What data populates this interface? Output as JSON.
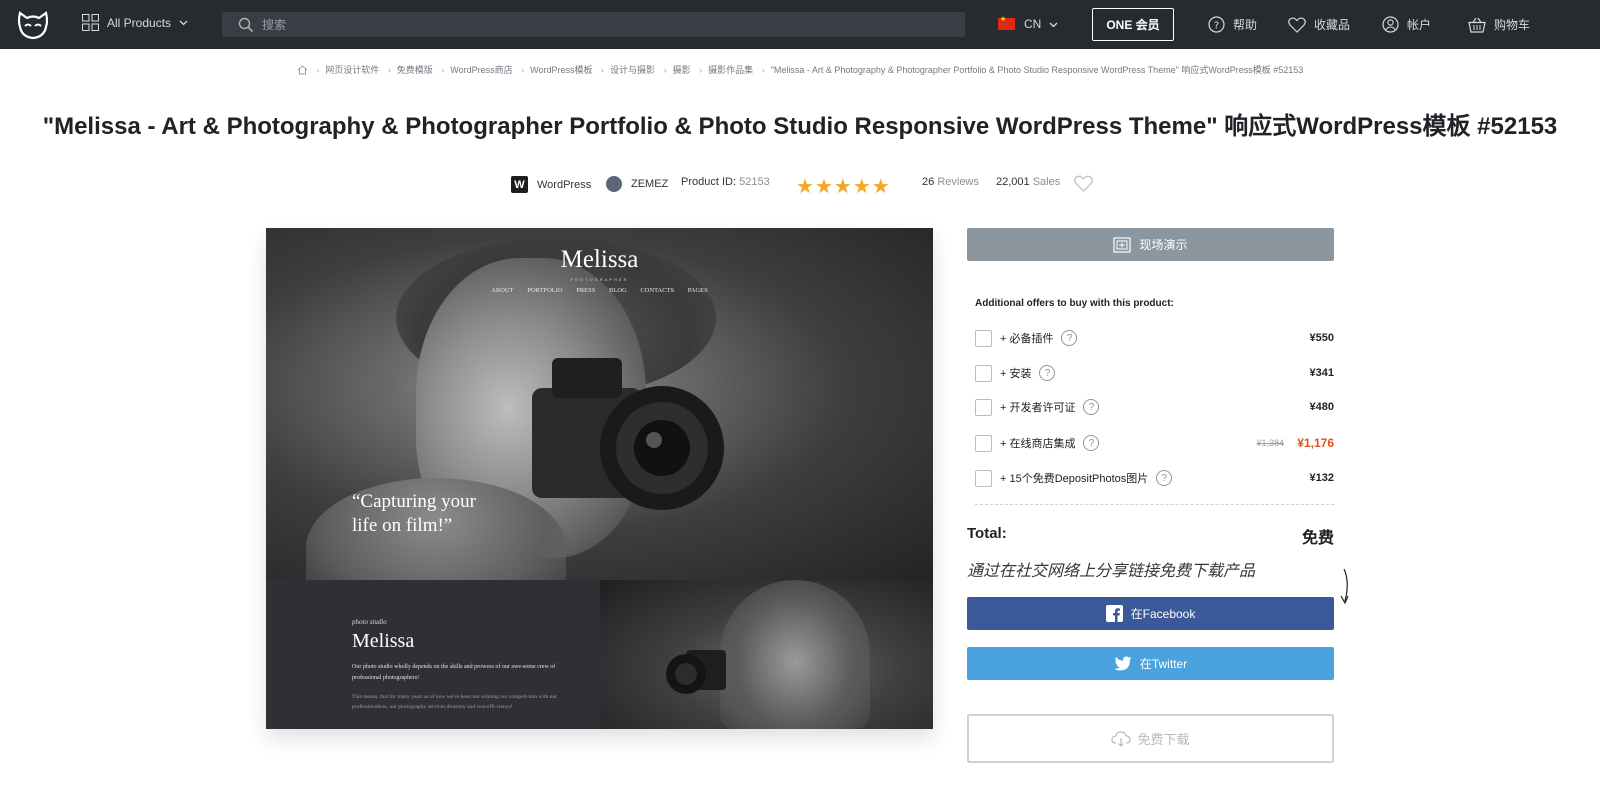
{
  "header": {
    "all_products": "All Products",
    "search_placeholder": "搜索",
    "lang": "CN",
    "one_member": "ONE 会员",
    "help": "帮助",
    "favorites": "收藏品",
    "account": "帐户",
    "cart": "购物车"
  },
  "breadcrumb": [
    "网页设计软件",
    "免费模版",
    "WordPress商店",
    "WordPress模板",
    "设计与摄影",
    "摄影",
    "摄影作品集",
    "\"Melissa - Art & Photography & Photographer Portfolio & Photo Studio Responsive WordPress Theme\" 响应式WordPress模板 #52153"
  ],
  "title": "\"Melissa - Art & Photography & Photographer Portfolio & Photo Studio Responsive WordPress Theme\" 响应式WordPress模板 #52153",
  "meta": {
    "platform": "WordPress",
    "author": "ZEMEZ",
    "product_id_label": "Product ID:",
    "product_id": "52153",
    "rating_stars": 5,
    "reviews_count": "26",
    "reviews_label": "Reviews",
    "sales_count": "22,001",
    "sales_label": "Sales"
  },
  "preview": {
    "brand": "Melissa",
    "brand_sub": "PHOTOGRAPHER",
    "menu": [
      "ABOUT",
      "PORTFOLIO",
      "PRESS",
      "BLOG",
      "CONTACTS",
      "PAGES"
    ],
    "quote": "“Capturing your\nlife on film!”",
    "studio_small": "photo studio",
    "studio_name": "Melissa",
    "studio_text1": "Our photo studio wholly depends on the skills and prowess of our awe-some crew of professional photographers!",
    "studio_text2": "This means, that for many years as of now we've been not winning our competi-tion with our professionalism, our photography services diversity and cost-effi-ciency!"
  },
  "panel": {
    "demo_label": "现场演示",
    "offers_title": "Additional offers to buy with this product:",
    "offers": [
      {
        "label": "+ 必备插件",
        "price": "¥550"
      },
      {
        "label": "+ 安装",
        "price": "¥341"
      },
      {
        "label": "+ 开发者许可证",
        "price": "¥480"
      },
      {
        "label": "+ 在线商店集成",
        "price_old": "¥1,384",
        "price": "¥1,176"
      },
      {
        "label": "+ 15个免费DepositPhotos图片",
        "price": "¥132"
      }
    ],
    "total_label": "Total:",
    "total_value": "免费",
    "share_text": "通过在社交网络上分享链接免费下载产品",
    "facebook_label": "在Facebook",
    "twitter_label": "在Twitter",
    "download_label": "免费下载"
  },
  "colors": {
    "topbar": "#272a2f",
    "facebook": "#3b5998",
    "twitter": "#4aa3df",
    "star": "#f5a623",
    "sale": "#e0531f"
  }
}
